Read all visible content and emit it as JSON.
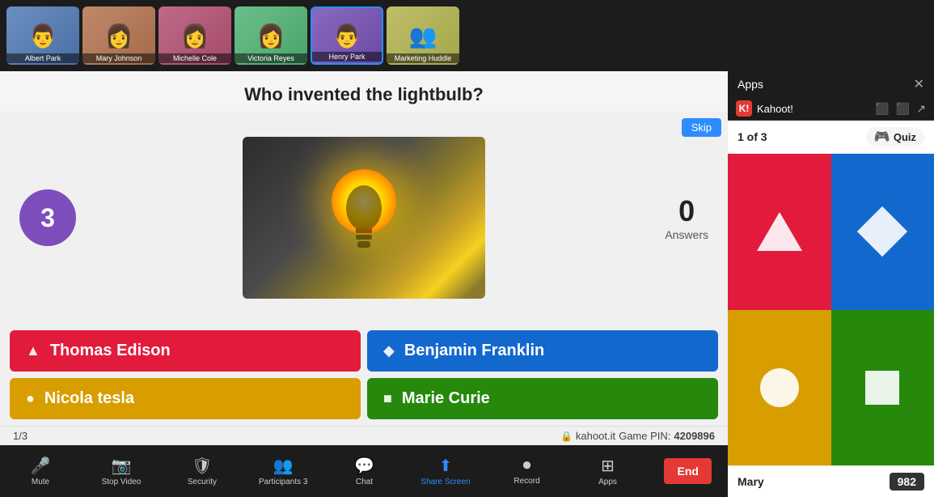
{
  "topBar": {
    "participants": [
      {
        "id": "albert",
        "name": "Albert Park",
        "avatarClass": "avatar-albert",
        "active": false,
        "icon": "👨"
      },
      {
        "id": "mary",
        "name": "Mary Johnson",
        "avatarClass": "avatar-mary",
        "active": false,
        "icon": "👩"
      },
      {
        "id": "michelle",
        "name": "Michelle Cole",
        "avatarClass": "avatar-michelle",
        "active": false,
        "icon": "👩"
      },
      {
        "id": "victoria",
        "name": "Victoria Reyes",
        "avatarClass": "avatar-victoria",
        "active": false,
        "icon": "👩"
      },
      {
        "id": "henry",
        "name": "Henry Park",
        "avatarClass": "avatar-henry",
        "active": true,
        "icon": "👨"
      },
      {
        "id": "marketing",
        "name": "Marketing Huddle",
        "avatarClass": "avatar-marketing",
        "active": false,
        "icon": "👥"
      }
    ]
  },
  "quiz": {
    "question": "Who invented the lightbulb?",
    "timer": "3",
    "answersCount": "0",
    "answersLabel": "Answers",
    "skipLabel": "Skip",
    "answers": [
      {
        "id": "a1",
        "text": "Thomas Edison",
        "color": "red",
        "shape": "triangle"
      },
      {
        "id": "a2",
        "text": "Benjamin Franklin",
        "color": "blue",
        "shape": "diamond"
      },
      {
        "id": "a3",
        "text": "Nicola tesla",
        "color": "yellow",
        "shape": "circle"
      },
      {
        "id": "a4",
        "text": "Marie Curie",
        "color": "green",
        "shape": "square"
      }
    ]
  },
  "statusBar": {
    "progress": "1/3",
    "lockIcon": "🔒",
    "site": "kahoot.it",
    "gamePinLabel": "Game PIN:",
    "gamePin": "4209896"
  },
  "toolbar": {
    "items": [
      {
        "id": "mute",
        "icon": "🎤",
        "label": "Mute",
        "hasArrow": false,
        "active": false
      },
      {
        "id": "stopvideo",
        "icon": "📷",
        "label": "Stop Video",
        "hasArrow": true,
        "active": false
      },
      {
        "id": "security",
        "icon": "🛡",
        "label": "Security",
        "hasArrow": false,
        "active": false
      },
      {
        "id": "participants",
        "icon": "👥",
        "label": "Participants",
        "hasArrow": false,
        "active": false,
        "badge": "3"
      },
      {
        "id": "chat",
        "icon": "💬",
        "label": "Chat",
        "hasArrow": false,
        "active": false
      },
      {
        "id": "sharescr",
        "icon": "⬆",
        "label": "Share Screen",
        "hasArrow": true,
        "active": true
      },
      {
        "id": "record",
        "icon": "⏺",
        "label": "Record",
        "hasArrow": false,
        "active": false
      },
      {
        "id": "apps",
        "icon": "⊞",
        "label": "Apps",
        "hasArrow": false,
        "active": false
      }
    ],
    "endLabel": "End"
  },
  "appsPanel": {
    "title": "Apps",
    "kahoot": {
      "name": "Kahoot!",
      "counter": "1 of 3",
      "badgeLabel": "Quiz",
      "shapes": [
        {
          "color": "red",
          "shape": "triangle"
        },
        {
          "color": "blue",
          "shape": "diamond"
        },
        {
          "color": "yellow",
          "shape": "circle"
        },
        {
          "color": "green",
          "shape": "square"
        }
      ],
      "leaderboard": [
        {
          "name": "Mary",
          "score": "982"
        }
      ]
    }
  }
}
